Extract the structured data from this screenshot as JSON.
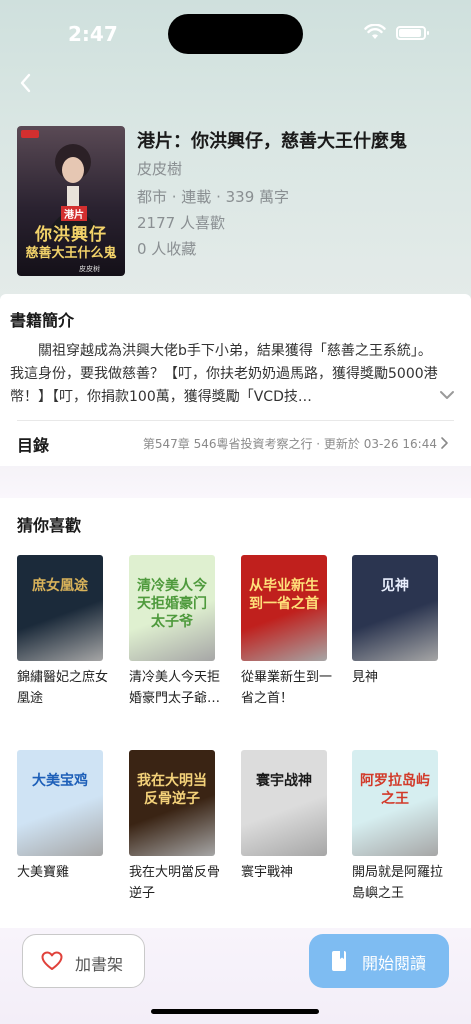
{
  "status": {
    "time": "2:47"
  },
  "book": {
    "title": "港片：你洪興仔，慈善大王什麼鬼",
    "author": "皮皮樹",
    "meta": "都市 · 連載 · 339 萬字",
    "likes": "2177 人喜歡",
    "collects": "0 人收藏",
    "cover_text_tag": "港片",
    "cover_text_line1": "你洪興仔",
    "cover_text_line2": "慈善大王什么鬼",
    "cover_author": "皮皮树"
  },
  "intro": {
    "title": "書籍簡介",
    "text": "關祖穿越成為洪興大佬b手下小弟，結果獲得「慈善之王系統」。我這身份，要我做慈善？【叮，你扶老奶奶過馬路，獲得獎勵5000港幣！】【叮，你捐款100萬，獲得獎勵「VCD技…"
  },
  "toc": {
    "label": "目錄",
    "latest": "第547章 546粵省投資考察之行 · 更新於 03-26 16:44"
  },
  "recommend": {
    "title": "猜你喜歡",
    "items": [
      {
        "name": "錦繡醫妃之庶女凰途",
        "cover_text": "庶女凰途",
        "cover_color": "#1b2a3a",
        "accent": "#d8b25a"
      },
      {
        "name": "清冷美人今天拒婚豪門太子爺…",
        "cover_text": "清冷美人今天拒婚豪门太子爷",
        "cover_color": "#dff0d0",
        "accent": "#4e9a3c"
      },
      {
        "name": "從畢業新生到一省之首！",
        "cover_text": "从毕业新生到一省之首",
        "cover_color": "#c0201d",
        "accent": "#ffe07a"
      },
      {
        "name": "見神",
        "cover_text": "见神",
        "cover_color": "#2b3550",
        "accent": "#e8eefc"
      },
      {
        "name": "大美寶雞",
        "cover_text": "大美宝鸡",
        "cover_color": "#cfe3f4",
        "accent": "#1d5fb8"
      },
      {
        "name": "我在大明當反骨逆子",
        "cover_text": "我在大明当反骨逆子",
        "cover_color": "#3a2414",
        "accent": "#f4d27a"
      },
      {
        "name": "寰宇戰神",
        "cover_text": "寰宇战神",
        "cover_color": "#dcdcdc",
        "accent": "#1a1a1a"
      },
      {
        "name": "開局就是阿羅拉島嶼之王",
        "cover_text": "阿罗拉岛屿之王",
        "cover_color": "#d6eef0",
        "accent": "#d23a2a"
      }
    ]
  },
  "actions": {
    "shelf_label": "加書架",
    "read_label": "開始閱讀"
  },
  "colors": {
    "primary": "#7ebcf2",
    "heart": "#e0413b"
  }
}
